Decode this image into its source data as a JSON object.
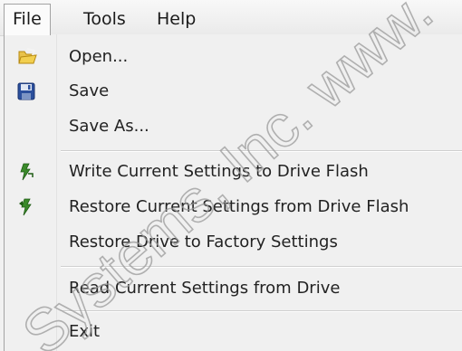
{
  "menubar": {
    "items": [
      {
        "label": "File"
      },
      {
        "label": "Tools"
      },
      {
        "label": "Help"
      }
    ],
    "active": "File"
  },
  "file_menu": {
    "items": [
      {
        "label": "Open...",
        "icon": "open-folder-icon"
      },
      {
        "label": "Save",
        "icon": "floppy-disk-icon"
      },
      {
        "label": "Save As...",
        "icon": null
      },
      {
        "label": "Write Current Settings to Drive Flash",
        "icon": "write-flash-icon"
      },
      {
        "label": "Restore Current Settings from Drive Flash",
        "icon": "restore-flash-icon"
      },
      {
        "label": "Restore Drive to Factory Settings",
        "icon": null
      },
      {
        "label": "Read Current Settings from Drive",
        "icon": null
      },
      {
        "label": "Exit",
        "icon": null
      }
    ]
  },
  "watermark": {
    "text": "Systems, Inc. www.",
    "color": "#9a9a9a"
  },
  "colors": {
    "folder_yellow": "#e3b322",
    "floppy_blue": "#2b4f9c",
    "flash_green": "#3a8a2a",
    "menu_text": "#222222"
  }
}
